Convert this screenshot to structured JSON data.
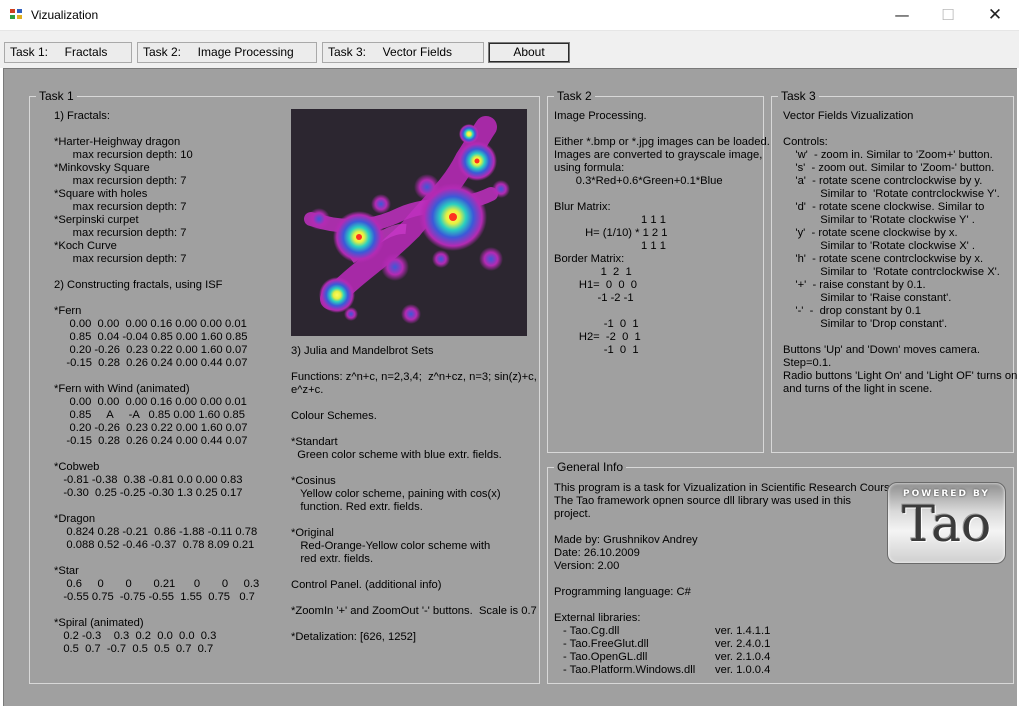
{
  "window": {
    "title": "Vizualization",
    "controls": {
      "minimize": "—",
      "maximize": "☐",
      "close": "✕"
    }
  },
  "tabs": [
    {
      "label": "Task 1:     Fractals"
    },
    {
      "label": "Task 2:     Image Processing"
    },
    {
      "label": "Task 3:     Vector Fields"
    },
    {
      "label": "About"
    }
  ],
  "task1": {
    "label": "Task 1",
    "fractals_text": "1) Fractals:\n\n*Harter-Heighway dragon\n      max recursion depth: 10\n*Minkovsky Square\n      max recursion depth: 7\n*Square with holes\n      max recursion depth: 7\n*Serpinski curpet\n      max recursion depth: 7\n*Koch Curve\n      max recursion depth: 7\n\n2) Constructing fractals, using ISF\n\n*Fern\n     0.00  0.00  0.00 0.16 0.00 0.00 0.01\n     0.85  0.04 -0.04 0.85 0.00 1.60 0.85\n     0.20 -0.26  0.23 0.22 0.00 1.60 0.07\n    -0.15  0.28  0.26 0.24 0.00 0.44 0.07\n\n*Fern with Wind (animated)\n     0.00  0.00  0.00 0.16 0.00 0.00 0.01\n     0.85     A     -A   0.85 0.00 1.60 0.85\n     0.20 -0.26  0.23 0.22 0.00 1.60 0.07\n    -0.15  0.28  0.26 0.24 0.00 0.44 0.07\n\n*Cobweb\n   -0.81 -0.38  0.38 -0.81 0.0 0.00 0.83\n   -0.30  0.25 -0.25 -0.30 1.3 0.25 0.17\n\n*Dragon\n    0.824 0.28 -0.21  0.86 -1.88 -0.11 0.78\n    0.088 0.52 -0.46 -0.37  0.78 8.09 0.21\n\n*Star\n    0.6     0       0       0.21      0       0     0.3\n   -0.55 0.75  -0.75 -0.55  1.55  0.75   0.7\n\n*Spiral (animated)\n   0.2 -0.3    0.3  0.2  0.0  0.0  0.3\n   0.5  0.7  -0.7  0.5  0.5  0.7  0.7",
    "julia_text": "3) Julia and Mandelbrot Sets\n\nFunctions: z^n+c, n=2,3,4;  z^n+cz, n=3; sin(z)+c,\ne^z+c.\n\nColour Schemes.\n\n*Standart\n  Green color scheme with blue extr. fields.\n\n*Cosinus\n   Yellow color scheme, paining with cos(x)\n   function. Red extr. fields.\n\n*Original\n   Red-Orange-Yellow color scheme with\n   red extr. fields.\n\nControl Panel. (additional info)\n\n*ZoomIn '+' and ZoomOut '-' buttons.  Scale is 0.7\n\n*Detalization: [626, 1252]"
  },
  "task2": {
    "label": "Task 2",
    "text": "Image Processing.\n\nEither *.bmp or *.jpg images can be loaded.\nImages are converted to grayscale image,\nusing formula:\n       0.3*Red+0.6*Green+0.1*Blue\n\nBlur Matrix:\n                            1 1 1\n          H= (1/10) * 1 2 1\n                            1 1 1\nBorder Matrix:\n               1  2  1\n        H1=  0  0  0\n              -1 -2 -1\n\n                -1  0  1\n        H2=  -2  0  1\n                -1  0  1"
  },
  "task3": {
    "label": "Task 3",
    "text": "Vector Fields Vizualization\n\nControls:\n    'w'  - zoom in. Similar to 'Zoom+' button.\n    's'  - zoom out. Similar to 'Zoom-' button.\n    'a'  - rotate scene contrclockwise by y.\n            Similar to  'Rotate contrclockwise Y'.\n    'd'  - rotate scene clockwise. Similar to\n            Similar to 'Rotate clockwise Y' .\n    'y'  - rotate scene clockwise by x.\n            Similar to 'Rotate clockwise X' .\n    'h'  - rotate scene contrclockwise by x.\n            Similar to  'Rotate contrclockwise X'.\n    '+'  - raise constant by 0.1.\n            Similar to 'Raise constant'.\n    '-'  -  drop constant by 0.1\n            Similar to 'Drop constant'.\n\nButtons 'Up' and 'Down' moves camera.\nStep=0.1.\nRadio buttons 'Light On' and 'Light OF' turns on\nand turns of the light in scene."
  },
  "general": {
    "label": "General Info",
    "text": "This program is a task for Vizualization in Scientific Research Course.\nThe Tao framework opnen source dll library was used in this\nproject.\n\nMade by: Grushnikov Andrey\nDate: 26.10.2009\nVersion: 2.00\n\nProgramming language: C#\n\nExternal libraries:",
    "libraries": [
      {
        "name": "- Tao.Cg.dll",
        "version": "ver. 1.4.1.1"
      },
      {
        "name": "- Tao.FreeGlut.dll",
        "version": "ver. 2.4.0.1"
      },
      {
        "name": "- Tao.OpenGL.dll",
        "version": "ver. 2.1.0.4"
      },
      {
        "name": "- Tao.Platform.Windows.dll",
        "version": "ver. 1.0.0.4"
      }
    ],
    "logo": {
      "powered": "POWERED BY",
      "word": "Tao"
    }
  },
  "colors": {
    "panel_bg": "#a0a0a0",
    "julia_bg": "#2c2630",
    "julia_fill": "#b42ab4",
    "julia_ring": "#3a5ad8",
    "julia_core": "#e8f040"
  }
}
